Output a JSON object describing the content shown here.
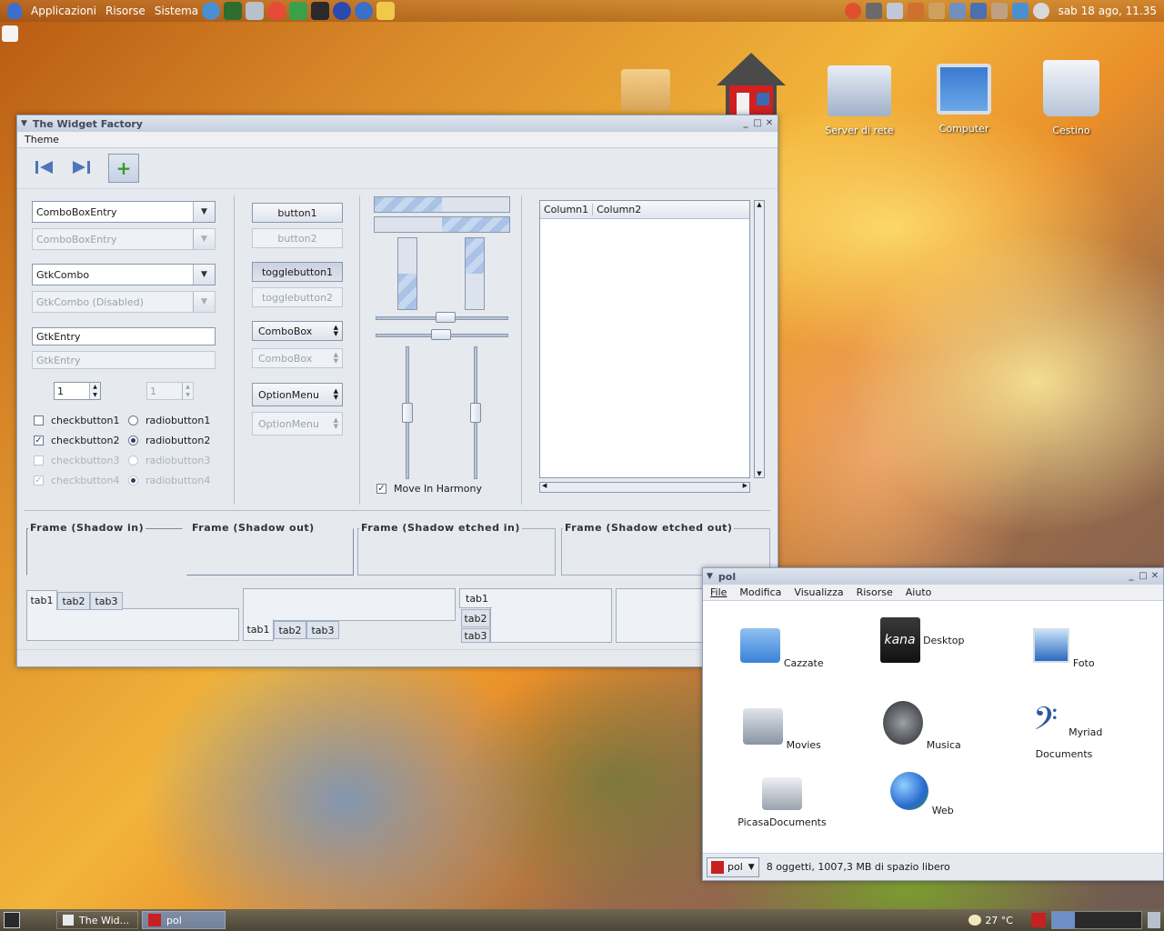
{
  "top_panel": {
    "menus": [
      "Applicazioni",
      "Risorse",
      "Sistema"
    ],
    "clock": "sab 18 ago, 11.35"
  },
  "desktop_icons": [
    {
      "label": ""
    },
    {
      "label": ""
    },
    {
      "label": "Server di rete"
    },
    {
      "label": "Computer"
    },
    {
      "label": "Cestino"
    }
  ],
  "widget_factory": {
    "title": "The Widget Factory",
    "menu": [
      "Theme"
    ],
    "combo_entry": "ComboBoxEntry",
    "combo_entry_disabled": "ComboBoxEntry",
    "gtkcombo": "GtkCombo",
    "gtkcombo_disabled": "GtkCombo (Disabled)",
    "entry": "GtkEntry",
    "entry_disabled": "GtkEntry",
    "spin1": "1",
    "spin2": "1",
    "checks": [
      "checkbutton1",
      "checkbutton2",
      "checkbutton3",
      "checkbutton4"
    ],
    "radios": [
      "radiobutton1",
      "radiobutton2",
      "radiobutton3",
      "radiobutton4"
    ],
    "button1": "button1",
    "button2": "button2",
    "toggle1": "togglebutton1",
    "toggle2": "togglebutton2",
    "combobox": "ComboBox",
    "combobox_disabled": "ComboBox",
    "optionmenu": "OptionMenu",
    "optionmenu_disabled": "OptionMenu",
    "move_in_harmony": "Move In Harmony",
    "tree_columns": [
      "Column1",
      "Column2"
    ],
    "frames": [
      "Frame (Shadow in)",
      "Frame (Shadow out)",
      "Frame (Shadow etched in)",
      "Frame (Shadow etched out)"
    ],
    "tabs": [
      "tab1",
      "tab2",
      "tab3"
    ]
  },
  "file_manager": {
    "title": "pol",
    "menu": [
      "File",
      "Modifica",
      "Visualizza",
      "Risorse",
      "Aiuto"
    ],
    "items": [
      "Cazzate",
      "Desktop",
      "Foto",
      "Movies",
      "Musica",
      "Myriad Documents",
      "PicasaDocuments",
      "Web"
    ],
    "location": "pol",
    "status": "8 oggetti, 1007,3 MB di spazio libero"
  },
  "bottom_panel": {
    "tasks": [
      "The Wid...",
      "pol"
    ],
    "weather": "27 °C"
  },
  "colors": {
    "accent": "#8ea2c0",
    "selection": "#a9c2e6"
  }
}
